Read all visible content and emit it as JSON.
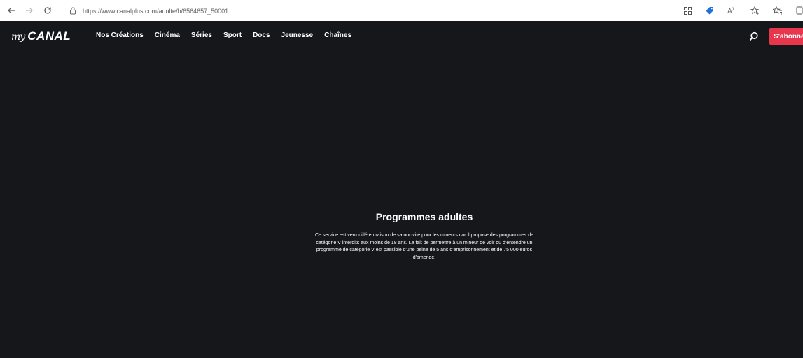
{
  "browser": {
    "url": "https://www.canalplus.com/adulte/h/6564657_50001",
    "icons": [
      "back-arrow-icon",
      "forward-arrow-icon",
      "reload-icon",
      "lock-icon",
      "apps-icon",
      "tag-icon",
      "read-aloud-icon",
      "add-favorite-icon",
      "favorites-icon",
      "collections-icon"
    ]
  },
  "site": {
    "logo_prefix": "my",
    "logo_name": "CANAL",
    "nav": [
      {
        "label": "Nos Créations"
      },
      {
        "label": "Cinéma"
      },
      {
        "label": "Séries"
      },
      {
        "label": "Sport"
      },
      {
        "label": "Docs"
      },
      {
        "label": "Jeunesse"
      },
      {
        "label": "Chaînes"
      }
    ],
    "subscribe_label": "S'abonner"
  },
  "main": {
    "title": "Programmes adultes",
    "message": "Ce service est verrouillé en raison de sa nocivité pour les mineurs car il propose des programmes de catégorie V interdits aux moins de 18 ans. Le fait de permettre à un mineur de voir ou d'entendre un programme de catégorie V est passible d'une peine de 5 ans d'emprisonnement et de 75 000 euros d'amende."
  },
  "colors": {
    "background": "#15171b",
    "accent": "#e8364d",
    "text": "#ffffff"
  }
}
